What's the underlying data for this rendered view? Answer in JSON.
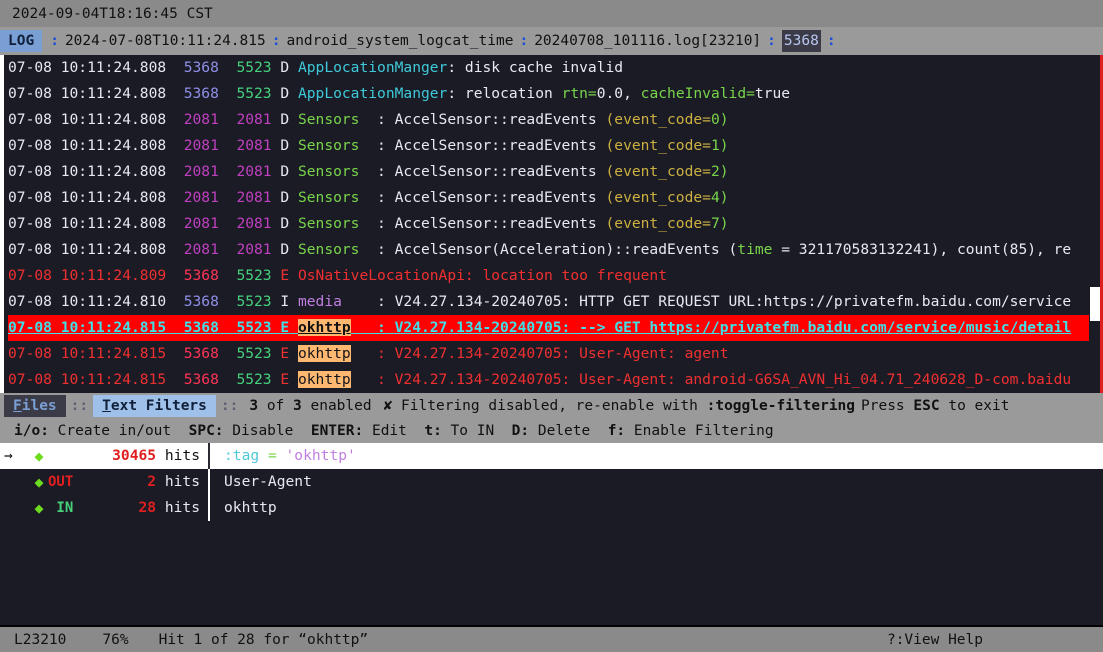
{
  "titlebar": {
    "datetime": "2024-09-04T18:16:45 CST"
  },
  "logheader": {
    "tag": "LOG",
    "sep": ":",
    "timestamp": "2024-07-08T10:11:24.815",
    "format": "android_system_logcat_time",
    "file": "20240708_101116.log[23210]",
    "pid_selected": "5368",
    "trailing_sep": ":"
  },
  "log_rows": [
    {
      "level": "D",
      "style": "debug",
      "date": "07-08",
      "time": "10:11:24.808",
      "pid": "5368",
      "tid": "5523",
      "pid_color": "blue",
      "tid_color": "green",
      "tag": "AppLocationManger",
      "tag_color": "cyan",
      "sep": ": ",
      "parts": [
        {
          "t": "disk cache invalid",
          "c": "msg"
        }
      ]
    },
    {
      "level": "D",
      "style": "debug",
      "date": "07-08",
      "time": "10:11:24.808",
      "pid": "5368",
      "tid": "5523",
      "pid_color": "blue",
      "tid_color": "green",
      "tag": "AppLocationManger",
      "tag_color": "cyan",
      "sep": ": ",
      "parts": [
        {
          "t": "relocation ",
          "c": "msg"
        },
        {
          "t": "rtn=",
          "c": "grn"
        },
        {
          "t": "0.0",
          "c": "msg"
        },
        {
          "t": ", ",
          "c": "msg"
        },
        {
          "t": "cacheInvalid=",
          "c": "grn"
        },
        {
          "t": "true",
          "c": "msg"
        }
      ]
    },
    {
      "level": "D",
      "style": "debug",
      "date": "07-08",
      "time": "10:11:24.808",
      "pid": "2081",
      "tid": "2081",
      "pid_color": "magenta",
      "tid_color": "magenta",
      "tag": "Sensors  ",
      "tag_color": "green",
      "sep": ": ",
      "parts": [
        {
          "t": "AccelSensor::readEvents ",
          "c": "msg"
        },
        {
          "t": "(event_code=",
          "c": "kv"
        },
        {
          "t": "0)",
          "c": "val"
        }
      ]
    },
    {
      "level": "D",
      "style": "debug",
      "date": "07-08",
      "time": "10:11:24.808",
      "pid": "2081",
      "tid": "2081",
      "pid_color": "magenta",
      "tid_color": "magenta",
      "tag": "Sensors  ",
      "tag_color": "green",
      "sep": ": ",
      "parts": [
        {
          "t": "AccelSensor::readEvents ",
          "c": "msg"
        },
        {
          "t": "(event_code=",
          "c": "kv"
        },
        {
          "t": "1)",
          "c": "val"
        }
      ]
    },
    {
      "level": "D",
      "style": "debug",
      "date": "07-08",
      "time": "10:11:24.808",
      "pid": "2081",
      "tid": "2081",
      "pid_color": "magenta",
      "tid_color": "magenta",
      "tag": "Sensors  ",
      "tag_color": "green",
      "sep": ": ",
      "parts": [
        {
          "t": "AccelSensor::readEvents ",
          "c": "msg"
        },
        {
          "t": "(event_code=",
          "c": "kv"
        },
        {
          "t": "2)",
          "c": "val"
        }
      ]
    },
    {
      "level": "D",
      "style": "debug",
      "date": "07-08",
      "time": "10:11:24.808",
      "pid": "2081",
      "tid": "2081",
      "pid_color": "magenta",
      "tid_color": "magenta",
      "tag": "Sensors  ",
      "tag_color": "green",
      "sep": ": ",
      "parts": [
        {
          "t": "AccelSensor::readEvents ",
          "c": "msg"
        },
        {
          "t": "(event_code=",
          "c": "kv"
        },
        {
          "t": "4)",
          "c": "val"
        }
      ]
    },
    {
      "level": "D",
      "style": "debug",
      "date": "07-08",
      "time": "10:11:24.808",
      "pid": "2081",
      "tid": "2081",
      "pid_color": "magenta",
      "tid_color": "magenta",
      "tag": "Sensors  ",
      "tag_color": "green",
      "sep": ": ",
      "parts": [
        {
          "t": "AccelSensor::readEvents ",
          "c": "msg"
        },
        {
          "t": "(event_code=",
          "c": "kv"
        },
        {
          "t": "7)",
          "c": "val"
        }
      ]
    },
    {
      "level": "D",
      "style": "debug",
      "date": "07-08",
      "time": "10:11:24.808",
      "pid": "2081",
      "tid": "2081",
      "pid_color": "magenta",
      "tid_color": "magenta",
      "tag": "Sensors  ",
      "tag_color": "green",
      "sep": ": ",
      "parts": [
        {
          "t": "AccelSensor(Acceleration)::readEvents (",
          "c": "msg"
        },
        {
          "t": "time",
          "c": "grn"
        },
        {
          "t": " = 321170583132241), count(85), re",
          "c": "msg"
        }
      ]
    },
    {
      "level": "E",
      "style": "error",
      "date": "07-08",
      "time": "10:11:24.809",
      "pid": "5368",
      "tid": "5523",
      "pid_color": "blue",
      "tid_color": "green",
      "tag": "OsNativeLocationApi",
      "tag_color": "errtag",
      "sep": ": ",
      "parts": [
        {
          "t": "location too frequent",
          "c": "err"
        }
      ]
    },
    {
      "level": "I",
      "style": "info",
      "date": "07-08",
      "time": "10:11:24.810",
      "pid": "5368",
      "tid": "5523",
      "pid_color": "blue",
      "tid_color": "green",
      "tag": "media    ",
      "tag_color": "magenta",
      "sep": ": ",
      "parts": [
        {
          "t": "V24.27.134-20240705: HTTP GET REQUEST URL:https://privatefm.baidu.com/service",
          "c": "msg"
        }
      ]
    },
    {
      "level": "E",
      "style": "selected",
      "date": "07-08",
      "time": "10:11:24.815",
      "pid": "5368",
      "tid": "5523",
      "pid_color": "blue",
      "tid_color": "green",
      "tag": "okhttp",
      "tag_color": "hl",
      "sep": "   : ",
      "parts": [
        {
          "t": "V24.27.134-20240705: --> GET https://privatefm.baidu.com/service/music/detail",
          "c": "msg"
        }
      ]
    },
    {
      "level": "E",
      "style": "error",
      "date": "07-08",
      "time": "10:11:24.815",
      "pid": "5368",
      "tid": "5523",
      "pid_color": "blue",
      "tid_color": "green",
      "tag": "okhttp",
      "tag_color": "hl",
      "sep": "   : ",
      "parts": [
        {
          "t": "V24.27.134-20240705: User-Agent: agent",
          "c": "err"
        }
      ]
    },
    {
      "level": "E",
      "style": "error",
      "date": "07-08",
      "time": "10:11:24.815",
      "pid": "5368",
      "tid": "5523",
      "pid_color": "blue",
      "tid_color": "green",
      "tag": "okhttp",
      "tag_color": "hl",
      "sep": "   : ",
      "parts": [
        {
          "t": "V24.27.134-20240705: User-Agent: android-G6SA_AVN_Hi_04.71_240628_D-com.baidu",
          "c": "err"
        }
      ]
    }
  ],
  "filter_status": {
    "tab_files": "Files",
    "tab_text_filters": "Text Filters",
    "enabled_count": "3",
    "enabled_of": " of ",
    "enabled_total": "3",
    "enabled_word": " enabled",
    "warn_icon": "✘",
    "warn_text": " Filtering disabled, re-enable with ",
    "warn_cmd": ":toggle-filtering",
    "exit_hint_pre": "Press ",
    "exit_hint_key": "ESC",
    "exit_hint_post": " to exit"
  },
  "filter_keys": [
    {
      "key": "i/o:",
      "label": " Create in/out"
    },
    {
      "key": "SPC:",
      "label": " Disable"
    },
    {
      "key": "ENTER:",
      "label": " Edit"
    },
    {
      "key": "t:",
      "label": " To IN"
    },
    {
      "key": "D:",
      "label": " Delete"
    },
    {
      "key": "f:",
      "label": " Enable Filtering"
    }
  ],
  "filters": [
    {
      "selected": true,
      "arrow": "→",
      "diamond": "◆",
      "direction": "",
      "hits_n": "30465",
      "hits_u": " hits",
      "expr_parts": [
        {
          "t": ":tag",
          "c": "k-tag"
        },
        {
          "t": " = ",
          "c": "k-eq"
        },
        {
          "t": "'okhttp'",
          "c": "k-str"
        }
      ]
    },
    {
      "selected": false,
      "arrow": "",
      "diamond": "◆",
      "direction": "OUT",
      "dir_class": "out",
      "hits_n": "2",
      "hits_u": " hits",
      "expr_parts": [
        {
          "t": "User-Agent",
          "c": ""
        }
      ]
    },
    {
      "selected": false,
      "arrow": "",
      "diamond": "◆",
      "direction": " IN",
      "dir_class": "in",
      "hits_n": "28",
      "hits_u": " hits",
      "expr_parts": [
        {
          "t": "okhttp",
          "c": ""
        }
      ]
    }
  ],
  "bottombar": {
    "line": "L23210",
    "percent": "76%",
    "hit_status": "Hit 1 of 28 for “okhttp”",
    "help": "?:View Help"
  },
  "colors": {
    "bg": "#1b1b26",
    "chrome": "#9a9a9a",
    "accent_blue": "#7a9fd4",
    "error_red": "#f03030",
    "selected_red": "#ff0000",
    "highlight_orange": "#ffb870",
    "green": "#79d44a",
    "cyan": "#3fc9d8"
  }
}
